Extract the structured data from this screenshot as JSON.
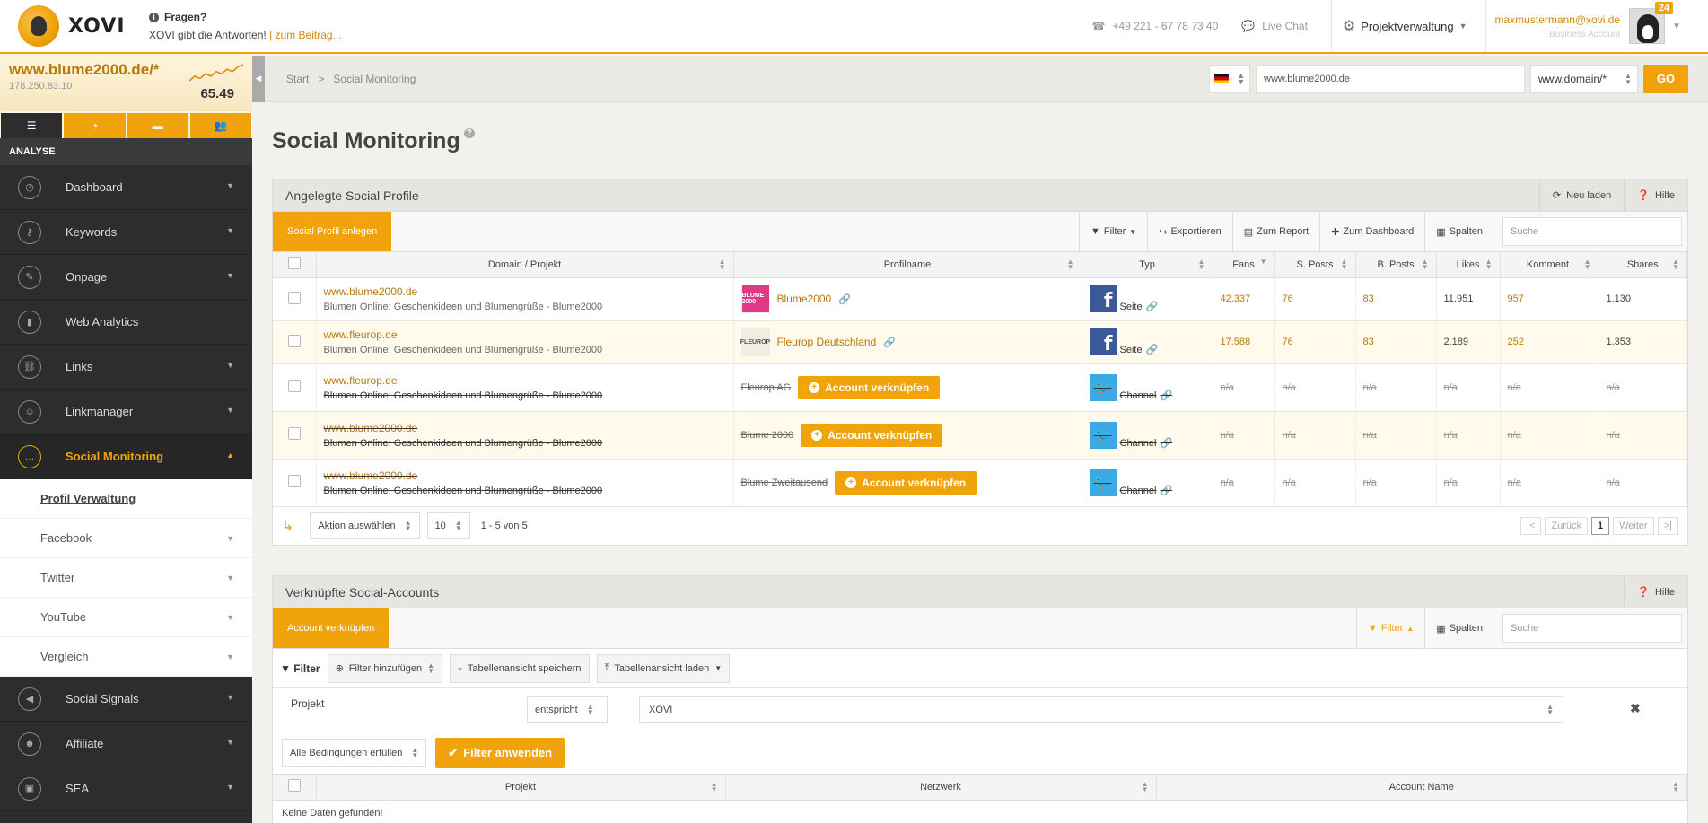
{
  "app": {
    "logo_text": "XOVI"
  },
  "help": {
    "title": "Fragen?",
    "text": "XOVI gibt die Antworten!",
    "link": "| zum Beitrag..."
  },
  "contact": {
    "phone": "+49 221 - 67 78 73 40",
    "chat": "Live Chat"
  },
  "project_menu": {
    "label": "Projektverwaltung"
  },
  "user": {
    "email": "maxmustermann@xovi.de",
    "account": "Business Account",
    "badge": "24"
  },
  "domain_box": {
    "domain": "www.blume2000.de/*",
    "ip": "178.250.83.10",
    "value": "65.49",
    "trend": [
      4,
      6,
      5,
      7,
      6,
      8,
      7,
      9,
      8,
      10,
      11
    ]
  },
  "sidebar": {
    "section": "ANALYSE",
    "items": [
      {
        "label": "Dashboard",
        "icon": "dashboard-icon"
      },
      {
        "label": "Keywords",
        "icon": "key-icon"
      },
      {
        "label": "Onpage",
        "icon": "wrench-icon"
      },
      {
        "label": "Web Analytics",
        "icon": "bar-chart-icon"
      },
      {
        "label": "Links",
        "icon": "link-icon"
      },
      {
        "label": "Linkmanager",
        "icon": "users-icon"
      },
      {
        "label": "Social Monitoring",
        "icon": "chat-icon"
      }
    ],
    "sub": [
      {
        "label": "Profil Verwaltung"
      },
      {
        "label": "Facebook"
      },
      {
        "label": "Twitter"
      },
      {
        "label": "YouTube"
      },
      {
        "label": "Vergleich"
      }
    ],
    "items2": [
      {
        "label": "Social Signals",
        "icon": "megaphone-icon"
      },
      {
        "label": "Affiliate",
        "icon": "people-icon"
      },
      {
        "label": "SEA",
        "icon": "ad-icon"
      }
    ]
  },
  "breadcrumb": {
    "start": "Start",
    "sep": ">",
    "current": "Social Monitoring"
  },
  "search": {
    "value": "www.blume2000.de",
    "domain_mode": "www.domain/*",
    "go": "GO"
  },
  "page": {
    "title": "Social Monitoring"
  },
  "panel1": {
    "title": "Angelegte Social Profile",
    "reload": "Neu laden",
    "help": "Hilfe",
    "create_btn": "Social Profil anlegen",
    "tools": {
      "filter": "Filter",
      "export": "Exportieren",
      "report": "Zum Report",
      "dashboard": "Zum Dashboard",
      "columns": "Spalten"
    },
    "search_placeholder": "Suche",
    "columns": [
      "Domain / Projekt",
      "Profilname",
      "Typ",
      "Fans",
      "S. Posts",
      "B. Posts",
      "Likes",
      "Komment.",
      "Shares"
    ],
    "rows": [
      {
        "domain": "www.blume2000.de",
        "desc": "Blumen Online: Geschenkideen und Blumengrüße - Blume2000",
        "profile": "Blume2000",
        "thumb": "BLUME 2000",
        "type": "Seite",
        "network": "facebook",
        "fans": "42.337",
        "sposts": "76",
        "bposts": "83",
        "likes": "11.951",
        "comments": "957",
        "shares": "1.130",
        "linked": true
      },
      {
        "domain": "www.fleurop.de",
        "desc": "Blumen Online: Geschenkideen und Blumengrüße - Blume2000",
        "profile": "Fleurop Deutschland",
        "thumb": "FLEUROP",
        "type": "Seite",
        "network": "facebook",
        "fans": "17.588",
        "sposts": "76",
        "bposts": "83",
        "likes": "2.189",
        "comments": "252",
        "shares": "1.353",
        "linked": true
      },
      {
        "domain": "www.fleurop.de",
        "desc": "Blumen Online: Geschenkideen und Blumengrüße - Blume2000",
        "profile": "Fleurop AG",
        "type": "Channel",
        "network": "twitter",
        "fans": "n/a",
        "sposts": "n/a",
        "bposts": "n/a",
        "likes": "n/a",
        "comments": "n/a",
        "shares": "n/a",
        "linked": false
      },
      {
        "domain": "www.blume2000.de",
        "desc": "Blumen Online: Geschenkideen und Blumengrüße - Blume2000",
        "profile": "Blume 2000",
        "type": "Channel",
        "network": "twitter",
        "fans": "n/a",
        "sposts": "n/a",
        "bposts": "n/a",
        "likes": "n/a",
        "comments": "n/a",
        "shares": "n/a",
        "linked": false
      },
      {
        "domain": "www.blume2000.de",
        "desc": "Blumen Online: Geschenkideen und Blumengrüße - Blume2000",
        "profile": "Blume Zweitausend",
        "type": "Channel",
        "network": "twitter",
        "fans": "n/a",
        "sposts": "n/a",
        "bposts": "n/a",
        "likes": "n/a",
        "comments": "n/a",
        "shares": "n/a",
        "linked": false
      }
    ],
    "connect_label": "Account verknüpfen",
    "action_select": "Aktion auswählen",
    "page_size": "10",
    "count": "1 - 5 von 5",
    "pager": {
      "first": "|<",
      "prev": "Zurück",
      "page": "1",
      "next": "Weiter",
      "last": ">|"
    }
  },
  "panel2": {
    "title": "Verknüpfte Social-Accounts",
    "help": "Hilfe",
    "connect_btn": "Account verknüpfen",
    "tools": {
      "filter": "Filter",
      "columns": "Spalten"
    },
    "search_placeholder": "Suche",
    "filter": {
      "label": "Filter",
      "add": "Filter hinzufügen",
      "save": "Tabellenansicht speichern",
      "load": "Tabellenansicht laden",
      "cond_label": "Projekt",
      "cond_op": "entspricht",
      "cond_value": "XOVI",
      "all_conditions": "Alle Bedingungen erfüllen",
      "apply": "Filter anwenden"
    },
    "columns": [
      "Projekt",
      "Netzwerk",
      "Account Name"
    ],
    "no_data": "Keine Daten gefunden!"
  }
}
